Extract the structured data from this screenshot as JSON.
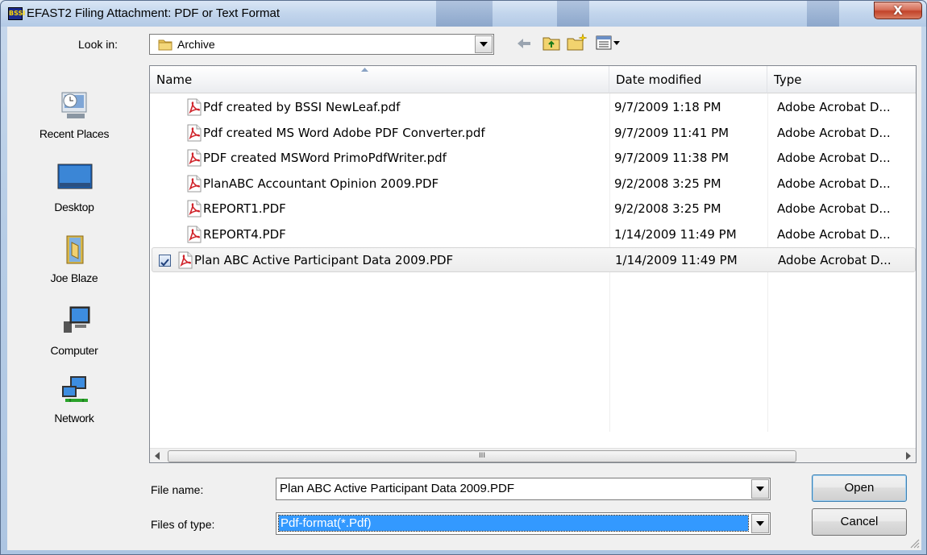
{
  "window": {
    "title": "EFAST2 Filing Attachment: PDF or Text Format",
    "app_icon_text": "BSSI",
    "close_symbol": "X"
  },
  "lookin": {
    "label": "Look in:",
    "value": "Archive"
  },
  "places": [
    {
      "label": "Recent Places",
      "icon": "recent-places-icon"
    },
    {
      "label": "Desktop",
      "icon": "desktop-icon"
    },
    {
      "label": "Joe Blaze",
      "icon": "user-folder-icon"
    },
    {
      "label": "Computer",
      "icon": "computer-icon"
    },
    {
      "label": "Network",
      "icon": "network-icon"
    }
  ],
  "columns": {
    "name": "Name",
    "date": "Date modified",
    "type": "Type"
  },
  "files": [
    {
      "name": "Pdf created by BSSI NewLeaf.pdf",
      "date": "9/7/2009 1:18 PM",
      "type": "Adobe Acrobat D..."
    },
    {
      "name": "Pdf created MS Word Adobe PDF Converter.pdf",
      "date": "9/7/2009 11:41 PM",
      "type": "Adobe Acrobat D..."
    },
    {
      "name": "PDF created MSWord PrimoPdfWriter.pdf",
      "date": "9/7/2009 11:38 PM",
      "type": "Adobe Acrobat D..."
    },
    {
      "name": "PlanABC Accountant Opinion 2009.PDF",
      "date": "9/2/2008 3:25 PM",
      "type": "Adobe Acrobat D..."
    },
    {
      "name": "REPORT1.PDF",
      "date": "9/2/2008 3:25 PM",
      "type": "Adobe Acrobat D..."
    },
    {
      "name": "REPORT4.PDF",
      "date": "1/14/2009 11:49 PM",
      "type": "Adobe Acrobat D..."
    },
    {
      "name": "Plan ABC Active Participant Data 2009.PDF",
      "date": "1/14/2009 11:49 PM",
      "type": "Adobe Acrobat D..."
    }
  ],
  "scroll_thumb_grip": "III",
  "filename": {
    "label": "File name:",
    "value": "Plan ABC Active Participant Data 2009.PDF"
  },
  "filetype": {
    "label": "Files of type:",
    "value": "Pdf-format(*.Pdf)"
  },
  "buttons": {
    "open": "Open",
    "cancel": "Cancel"
  },
  "colors": {
    "selection_highlight": "#3399ff",
    "close_button": "#c2432a",
    "pdf_icon_red": "#d0242b"
  }
}
